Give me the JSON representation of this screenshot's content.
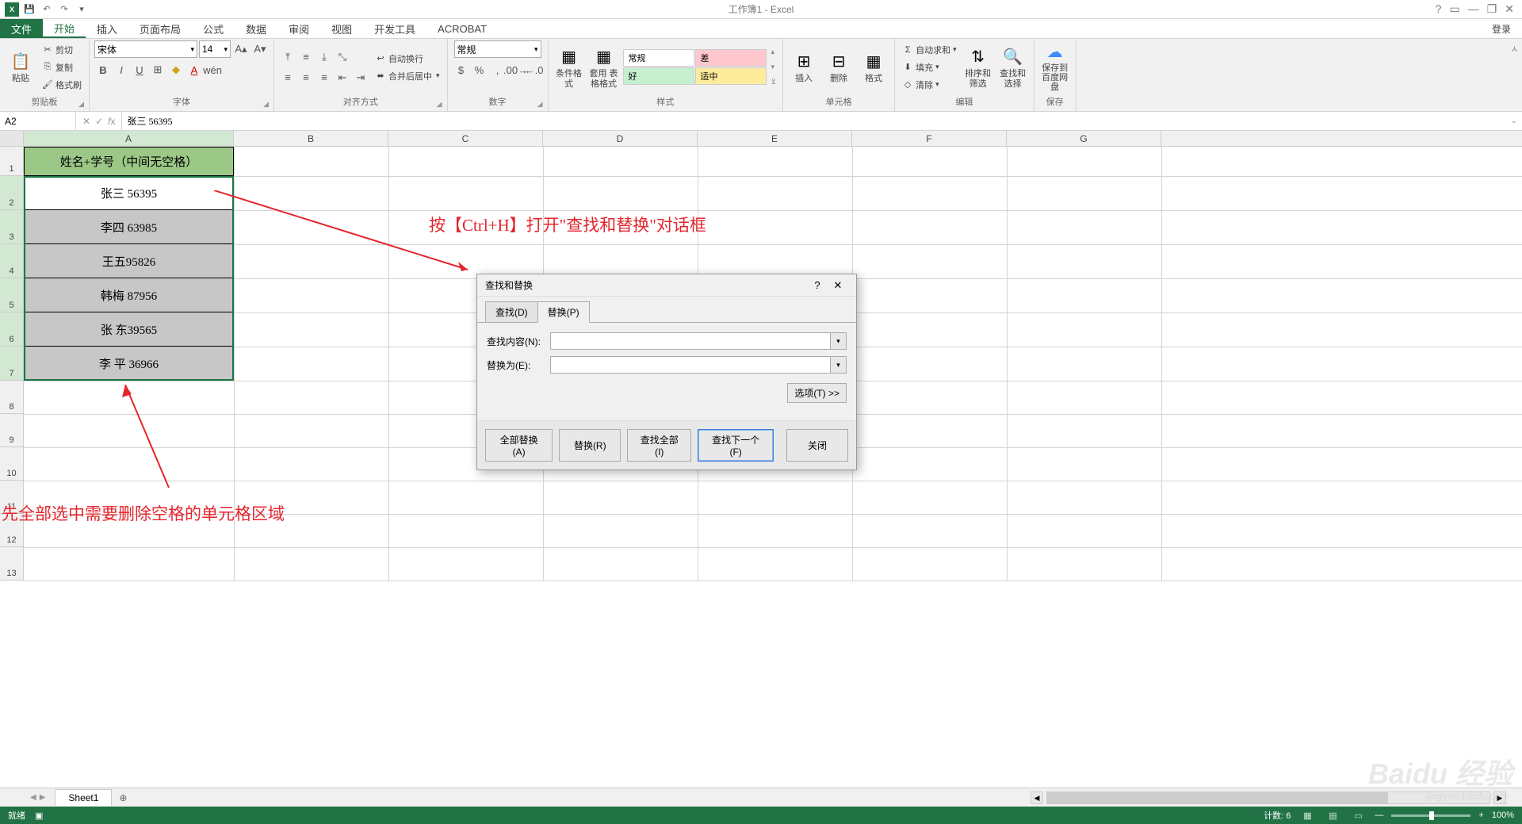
{
  "app": {
    "title": "工作簿1 - Excel",
    "login": "登录"
  },
  "qat": {
    "save": "💾",
    "undo": "↶",
    "redo": "↷"
  },
  "tabs": [
    "文件",
    "开始",
    "插入",
    "页面布局",
    "公式",
    "数据",
    "审阅",
    "视图",
    "开发工具",
    "ACROBAT"
  ],
  "ribbon": {
    "clipboard": {
      "label": "剪贴板",
      "paste": "粘贴",
      "cut": "剪切",
      "copy": "复制",
      "painter": "格式刷"
    },
    "font": {
      "label": "字体",
      "name": "宋体",
      "size": "14"
    },
    "align": {
      "label": "对齐方式",
      "wrap": "自动换行",
      "merge": "合并后居中"
    },
    "number": {
      "label": "数字",
      "format": "常规"
    },
    "styles": {
      "label": "样式",
      "cond": "条件格式",
      "table": "套用\n表格格式",
      "normal": "常规",
      "bad": "差",
      "good": "好",
      "neutral": "适中"
    },
    "cells": {
      "label": "单元格",
      "insert": "插入",
      "delete": "删除",
      "format": "格式"
    },
    "editing": {
      "label": "编辑",
      "sum": "自动求和",
      "fill": "填充",
      "clear": "清除",
      "sort": "排序和筛选",
      "find": "查找和选择"
    },
    "save": {
      "label": "保存",
      "btn": "保存到\n百度网盘"
    }
  },
  "formula": {
    "cell": "A2",
    "value": "张三  56395"
  },
  "cols": [
    "A",
    "B",
    "C",
    "D",
    "E",
    "F",
    "G"
  ],
  "rows": {
    "header": "姓名+学号（中间无空格）",
    "data": [
      "张三  56395",
      "李四  63985",
      "王五95826",
      "韩梅  87956",
      "张  东39565",
      "李  平  36966"
    ]
  },
  "dialog": {
    "title": "查找和替换",
    "tabs": {
      "find": "查找(D)",
      "replace": "替换(P)"
    },
    "findLabel": "查找内容(N):",
    "replaceLabel": "替换为(E):",
    "options": "选项(T) >>",
    "btnReplaceAll": "全部替换(A)",
    "btnReplace": "替换(R)",
    "btnFindAll": "查找全部(I)",
    "btnFindNext": "查找下一个(F)",
    "btnClose": "关闭"
  },
  "annotations": {
    "top": "按【Ctrl+H】打开\"查找和替换\"对话框",
    "bottom": "先全部选中需要删除空格的单元格区域"
  },
  "sheet": {
    "name": "Sheet1"
  },
  "status": {
    "ready": "就绪",
    "count": "计数: 6",
    "zoom": "100%"
  },
  "watermark": {
    "main": "Baidu 经验",
    "sub": "jingyan.baidu.com"
  }
}
